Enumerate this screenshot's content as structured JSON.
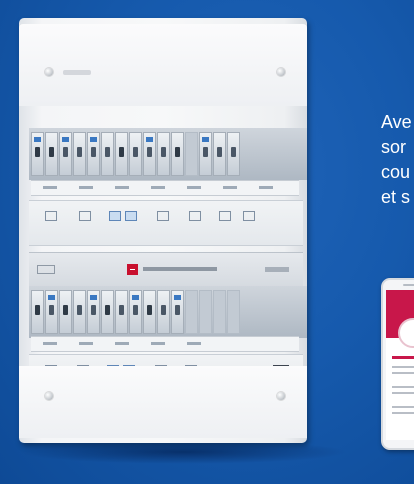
{
  "promo": {
    "lines": [
      "Ave",
      "sor",
      "cou",
      "et s"
    ]
  },
  "colors": {
    "background": "#165aad",
    "brand_red": "#c8102e",
    "app_accent": "#c8174a"
  },
  "icons": {
    "panel_logo": "legrand-logo-icon",
    "qr_code": "qr-code-icon",
    "app_header": "app-header-icon"
  }
}
